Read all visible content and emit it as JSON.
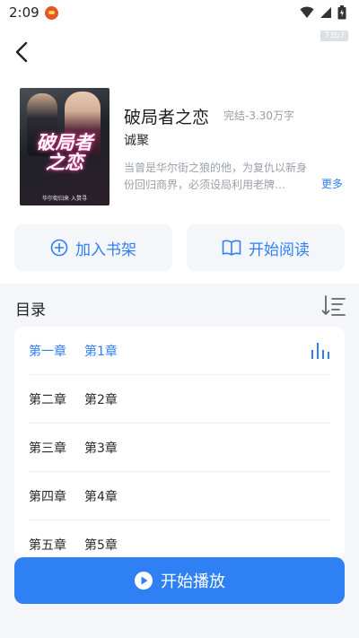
{
  "status_bar": {
    "time": "2:09"
  },
  "watermark": "73b7",
  "book": {
    "cover_title_line1": "破局者",
    "cover_title_line2": "之恋",
    "cover_tagline": "华尔街归来 入赘寻",
    "title": "破局者之恋",
    "meta": "完结-3.30万字",
    "author": "诚聚",
    "description": "当曾是华尔街之狼的他，为复仇以新身份回归商界，必须设局利用老牌…",
    "more_label": "更多"
  },
  "actions": {
    "add_shelf_label": "加入书架",
    "start_read_label": "开始阅读"
  },
  "catalog": {
    "title": "目录",
    "chapters": [
      {
        "num": "第一章",
        "name": "第1章",
        "active": true
      },
      {
        "num": "第二章",
        "name": "第2章",
        "active": false
      },
      {
        "num": "第三章",
        "name": "第3章",
        "active": false
      },
      {
        "num": "第四章",
        "name": "第4章",
        "active": false
      },
      {
        "num": "第五章",
        "name": "第5章",
        "active": false
      }
    ]
  },
  "play": {
    "label": "开始播放"
  },
  "colors": {
    "accent": "#2f7ff5",
    "panel_bg": "#f4f6fa",
    "muted_text": "#9aa0a8"
  }
}
